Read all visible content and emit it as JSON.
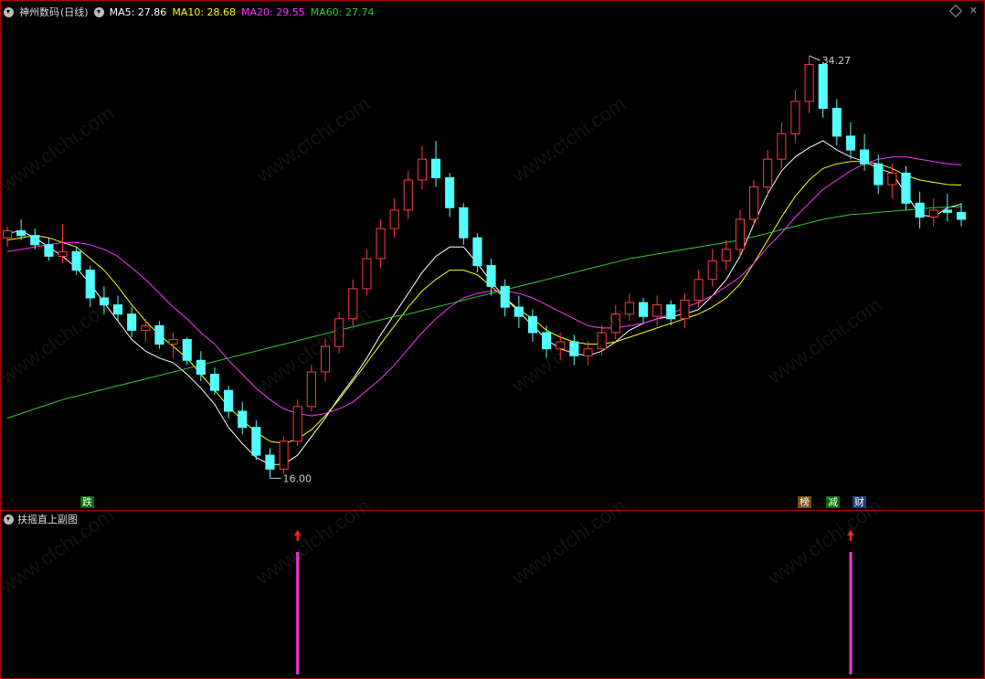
{
  "header": {
    "stock_name": "神州数码",
    "period": "(日线)",
    "ma5_label": "MA5: 27.86",
    "ma10_label": "MA10: 28.68",
    "ma20_label": "MA20: 29.55",
    "ma60_label": "MA60: 27.74"
  },
  "colors": {
    "up": "#ff3b3b",
    "down": "#54ffff",
    "ma5": "#ffffff",
    "ma10": "#ffff00",
    "ma20": "#ff33ff",
    "ma60": "#33cc33",
    "frame": "#b00000",
    "signal": "#ff33cc",
    "arrow": "#ff2020"
  },
  "annotations": {
    "high_label": "34.27",
    "low_label": "16.00"
  },
  "event_tags": {
    "tag_die": "跌",
    "tag_bang": "榜",
    "tag_jian": "减",
    "tag_cai": "财"
  },
  "sub_panel": {
    "title": "扶摇直上副图"
  },
  "watermark": "www.cfchi.com",
  "chart_data": [
    {
      "type": "candlestick",
      "title": "",
      "ylim": [
        15.5,
        35.5
      ],
      "grid": false,
      "series": [
        {
          "name": "MA5",
          "values": [
            26.6,
            26.7,
            26.4,
            26.0,
            25.6,
            25.1,
            24.4,
            23.6,
            22.8,
            22.0,
            21.5,
            21.2,
            21.0,
            20.5,
            19.9,
            19.2,
            18.2,
            17.5,
            16.9,
            16.6,
            16.6,
            17.0,
            17.8,
            18.6,
            19.5,
            20.3,
            21.2,
            22.2,
            23.1,
            24.0,
            24.9,
            25.6,
            26.0,
            26.0,
            25.3,
            24.5,
            23.8,
            23.2,
            22.6,
            22.0,
            21.6,
            21.4,
            21.3,
            21.5,
            21.9,
            22.4,
            22.7,
            22.9,
            23.0,
            23.1,
            23.3,
            23.9,
            24.6,
            25.6,
            27.0,
            28.3,
            29.3,
            29.9,
            30.3,
            30.6,
            30.2,
            29.9,
            29.7,
            29.4,
            29.2,
            28.3,
            27.4,
            27.3,
            27.7,
            27.86
          ]
        },
        {
          "name": "MA10",
          "values": [
            26.3,
            26.4,
            26.5,
            26.4,
            26.2,
            26.0,
            25.5,
            25.0,
            24.3,
            23.5,
            22.8,
            22.2,
            21.7,
            21.2,
            20.5,
            19.8,
            19.1,
            18.5,
            18.0,
            17.6,
            17.5,
            17.7,
            18.1,
            18.7,
            19.4,
            20.2,
            21.0,
            21.8,
            22.6,
            23.4,
            24.1,
            24.6,
            25.0,
            25.0,
            24.8,
            24.3,
            23.8,
            23.3,
            22.9,
            22.4,
            22.1,
            21.9,
            21.8,
            21.8,
            21.9,
            22.1,
            22.3,
            22.5,
            22.7,
            22.9,
            23.1,
            23.4,
            23.8,
            24.4,
            25.3,
            26.3,
            27.3,
            28.2,
            28.9,
            29.4,
            29.6,
            29.7,
            29.7,
            29.6,
            29.4,
            29.1,
            28.9,
            28.8,
            28.7,
            28.68
          ]
        },
        {
          "name": "MA20",
          "values": [
            25.8,
            25.9,
            26.0,
            26.1,
            26.2,
            26.2,
            26.1,
            25.9,
            25.6,
            25.1,
            24.6,
            24.0,
            23.4,
            22.9,
            22.3,
            21.8,
            21.1,
            20.5,
            19.9,
            19.4,
            19.0,
            18.8,
            18.7,
            18.8,
            19.0,
            19.3,
            19.8,
            20.3,
            20.9,
            21.6,
            22.3,
            22.9,
            23.4,
            23.8,
            24.0,
            24.1,
            24.1,
            24.0,
            23.8,
            23.5,
            23.2,
            22.9,
            22.6,
            22.5,
            22.5,
            22.6,
            22.7,
            22.9,
            23.1,
            23.4,
            23.6,
            23.9,
            24.3,
            24.7,
            25.3,
            26.0,
            26.6,
            27.3,
            27.9,
            28.5,
            28.9,
            29.3,
            29.6,
            29.8,
            29.9,
            29.9,
            29.8,
            29.7,
            29.6,
            29.55
          ]
        },
        {
          "name": "MA60",
          "values": [
            18.6,
            18.8,
            19.0,
            19.2,
            19.4,
            19.55,
            19.7,
            19.85,
            20.0,
            20.15,
            20.3,
            20.45,
            20.6,
            20.75,
            20.9,
            21.05,
            21.2,
            21.35,
            21.5,
            21.65,
            21.8,
            21.95,
            22.1,
            22.25,
            22.4,
            22.55,
            22.7,
            22.85,
            23.0,
            23.1,
            23.25,
            23.4,
            23.55,
            23.7,
            23.85,
            24.0,
            24.15,
            24.3,
            24.45,
            24.6,
            24.75,
            24.9,
            25.05,
            25.2,
            25.35,
            25.5,
            25.6,
            25.7,
            25.8,
            25.9,
            26.0,
            26.1,
            26.2,
            26.3,
            26.45,
            26.6,
            26.75,
            26.9,
            27.05,
            27.2,
            27.3,
            27.4,
            27.45,
            27.5,
            27.55,
            27.6,
            27.65,
            27.7,
            27.72,
            27.74
          ]
        }
      ],
      "ohlc": [
        [
          26.4,
          26.9,
          26.0,
          26.7
        ],
        [
          26.7,
          27.2,
          26.3,
          26.5
        ],
        [
          26.5,
          26.8,
          25.9,
          26.1
        ],
        [
          26.1,
          26.4,
          25.4,
          25.6
        ],
        [
          25.6,
          27.0,
          25.3,
          25.8
        ],
        [
          25.8,
          26.0,
          24.8,
          25.0
        ],
        [
          25.0,
          25.2,
          23.4,
          23.8
        ],
        [
          23.8,
          24.3,
          23.1,
          23.5
        ],
        [
          23.5,
          23.9,
          22.8,
          23.1
        ],
        [
          23.1,
          23.4,
          22.1,
          22.4
        ],
        [
          22.4,
          22.9,
          21.9,
          22.6
        ],
        [
          22.6,
          22.8,
          21.6,
          21.8
        ],
        [
          21.8,
          22.3,
          21.2,
          22.0
        ],
        [
          22.0,
          22.1,
          20.9,
          21.1
        ],
        [
          21.1,
          21.5,
          20.2,
          20.5
        ],
        [
          20.5,
          20.8,
          19.6,
          19.8
        ],
        [
          19.8,
          20.0,
          18.6,
          18.9
        ],
        [
          18.9,
          19.3,
          17.9,
          18.2
        ],
        [
          18.2,
          18.5,
          16.8,
          17.0
        ],
        [
          17.0,
          17.3,
          16.0,
          16.4
        ],
        [
          16.4,
          17.8,
          16.2,
          17.6
        ],
        [
          17.6,
          19.4,
          17.4,
          19.1
        ],
        [
          19.1,
          20.9,
          18.9,
          20.6
        ],
        [
          20.6,
          22.0,
          20.2,
          21.7
        ],
        [
          21.7,
          23.2,
          21.4,
          22.9
        ],
        [
          22.9,
          24.6,
          22.6,
          24.2
        ],
        [
          24.2,
          25.9,
          23.9,
          25.5
        ],
        [
          25.5,
          27.2,
          25.1,
          26.8
        ],
        [
          26.8,
          28.1,
          26.4,
          27.6
        ],
        [
          27.6,
          29.3,
          27.2,
          28.9
        ],
        [
          28.9,
          30.4,
          28.5,
          29.8
        ],
        [
          29.8,
          30.6,
          28.6,
          29.0
        ],
        [
          29.0,
          29.2,
          27.3,
          27.7
        ],
        [
          27.7,
          27.9,
          26.1,
          26.4
        ],
        [
          26.4,
          26.6,
          24.9,
          25.2
        ],
        [
          25.2,
          25.5,
          23.9,
          24.3
        ],
        [
          24.3,
          24.6,
          23.0,
          23.4
        ],
        [
          23.4,
          23.9,
          22.5,
          23.0
        ],
        [
          23.0,
          23.3,
          21.9,
          22.3
        ],
        [
          22.3,
          22.6,
          21.2,
          21.6
        ],
        [
          21.6,
          22.3,
          21.1,
          21.9
        ],
        [
          21.9,
          22.2,
          20.9,
          21.3
        ],
        [
          21.3,
          21.9,
          20.9,
          21.6
        ],
        [
          21.6,
          22.6,
          21.3,
          22.3
        ],
        [
          22.3,
          23.5,
          22.0,
          23.1
        ],
        [
          23.1,
          24.0,
          22.8,
          23.6
        ],
        [
          23.6,
          23.8,
          22.7,
          23.0
        ],
        [
          23.0,
          23.9,
          22.6,
          23.5
        ],
        [
          23.5,
          23.7,
          22.6,
          22.9
        ],
        [
          22.9,
          24.0,
          22.5,
          23.7
        ],
        [
          23.7,
          25.0,
          23.4,
          24.6
        ],
        [
          24.6,
          25.9,
          24.3,
          25.4
        ],
        [
          25.4,
          26.3,
          25.0,
          25.9
        ],
        [
          25.9,
          27.6,
          25.6,
          27.2
        ],
        [
          27.2,
          28.9,
          26.9,
          28.6
        ],
        [
          28.6,
          30.2,
          28.2,
          29.8
        ],
        [
          29.8,
          31.4,
          29.4,
          30.9
        ],
        [
          30.9,
          32.8,
          30.5,
          32.3
        ],
        [
          32.3,
          34.27,
          31.8,
          33.9
        ],
        [
          33.9,
          34.0,
          31.6,
          32.0
        ],
        [
          32.0,
          32.4,
          30.4,
          30.8
        ],
        [
          30.8,
          31.4,
          29.8,
          30.2
        ],
        [
          30.2,
          30.9,
          29.3,
          29.6
        ],
        [
          29.6,
          30.0,
          28.3,
          28.7
        ],
        [
          28.7,
          29.6,
          28.1,
          29.2
        ],
        [
          29.2,
          29.5,
          27.6,
          27.9
        ],
        [
          27.9,
          28.4,
          26.8,
          27.3
        ],
        [
          27.3,
          28.1,
          26.9,
          27.6
        ],
        [
          27.6,
          28.3,
          27.1,
          27.5
        ],
        [
          27.5,
          27.9,
          26.9,
          27.2
        ]
      ]
    },
    {
      "type": "bar",
      "title": "",
      "series": [
        {
          "name": "",
          "values": [
            0,
            0,
            0,
            0,
            0,
            0,
            0,
            0,
            0,
            0,
            0,
            0,
            0,
            0,
            0,
            0,
            0,
            0,
            0,
            0,
            0,
            1,
            0,
            0,
            0,
            0,
            0,
            0,
            0,
            0,
            0,
            0,
            0,
            0,
            0,
            0,
            0,
            0,
            0,
            0,
            0,
            0,
            0,
            0,
            0,
            0,
            0,
            0,
            0,
            0,
            0,
            0,
            0,
            0,
            0,
            0,
            0,
            0,
            0,
            0,
            0,
            1,
            0,
            0,
            0,
            0,
            0,
            0,
            0,
            0
          ]
        }
      ]
    }
  ]
}
